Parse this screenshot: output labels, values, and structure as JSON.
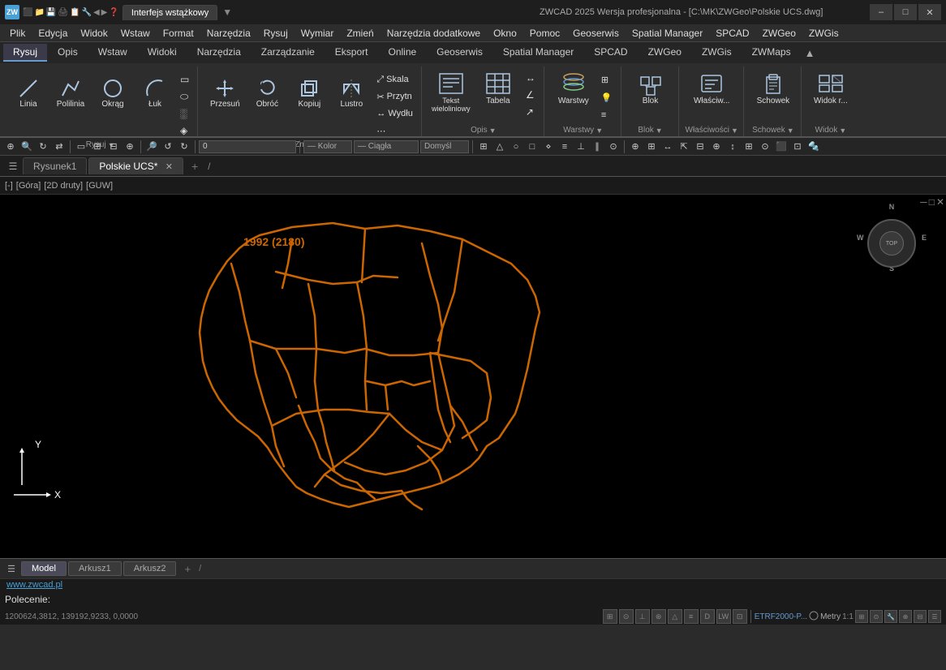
{
  "titlebar": {
    "app_icon": "Z",
    "tab1_label": "Interfejs wstążkowy",
    "title_main": "ZWCAD 2025 Wersja profesjonalna - [C:\\MK\\ZWGeo\\Polskie UCS.dwg]",
    "win_minimize": "–",
    "win_restore": "□",
    "win_close": "✕"
  },
  "menubar": {
    "items": [
      "Plik",
      "Edycja",
      "Widok",
      "Wstaw",
      "Format",
      "Narzędzia",
      "Rysuj",
      "Wymiar",
      "Zmień",
      "Narzędzia dodatkowe",
      "Okno",
      "Pomoc",
      "Geoserwis",
      "Spatial Manager",
      "SPCAD",
      "ZWGeo",
      "ZWGis"
    ]
  },
  "ribbon": {
    "tabs": [
      "Rysuj",
      "Opis",
      "Wstaw",
      "Widoki",
      "Narzędzia",
      "Zarządzanie",
      "Eksport",
      "Online",
      "Geoserwis",
      "Spatial Manager",
      "SPCAD",
      "ZWGeo",
      "ZWGis",
      "ZWMaps"
    ],
    "active_tab": "Rysuj",
    "groups": [
      {
        "name": "Rysuj",
        "items": [
          "Linia",
          "Polilinia",
          "Okrąg",
          "Łuk"
        ]
      },
      {
        "name": "Zmień",
        "items": [
          "Przesuń",
          "Obróć",
          "Kopiuj",
          "Lustro"
        ]
      },
      {
        "name": "Opis",
        "items": [
          "Tekst wieloliniowy",
          "Tabela"
        ]
      },
      {
        "name": "Warstwy",
        "items": [
          "Warstwy"
        ]
      },
      {
        "name": "Blok",
        "items": [
          "Blok"
        ]
      },
      {
        "name": "Właściwości",
        "items": [
          "Właściw..."
        ]
      },
      {
        "name": "Schowek",
        "items": [
          "Schowek"
        ]
      },
      {
        "name": "Widok",
        "items": [
          "Widok r..."
        ]
      }
    ]
  },
  "doc_tabs": {
    "tabs": [
      "Rysunek1",
      "Polskie UCS*"
    ],
    "active": "Polskie UCS*"
  },
  "view_bar": {
    "label": "[-]",
    "view": "[Góra]",
    "mode": "[2D druty]",
    "ucs": "[GUW]"
  },
  "map": {
    "label": "1992 (2180)",
    "label_color": "#cc6600"
  },
  "compass": {
    "N": "N",
    "S": "S",
    "E": "E",
    "W": "W",
    "center": "TOP"
  },
  "axis": {
    "y": "Y",
    "x": "X"
  },
  "sheet_tabs": {
    "tabs": [
      "Model",
      "Arkusz1",
      "Arkusz2"
    ],
    "active": "Model"
  },
  "status": {
    "website": "www.zwcad.pl",
    "command_prompt": "Polecenie:",
    "coordinates": "1200624,3812,  139192,9233,  0,0000",
    "projection": "ETRF2000-P...",
    "units": "Metry",
    "scale": "1:1"
  }
}
